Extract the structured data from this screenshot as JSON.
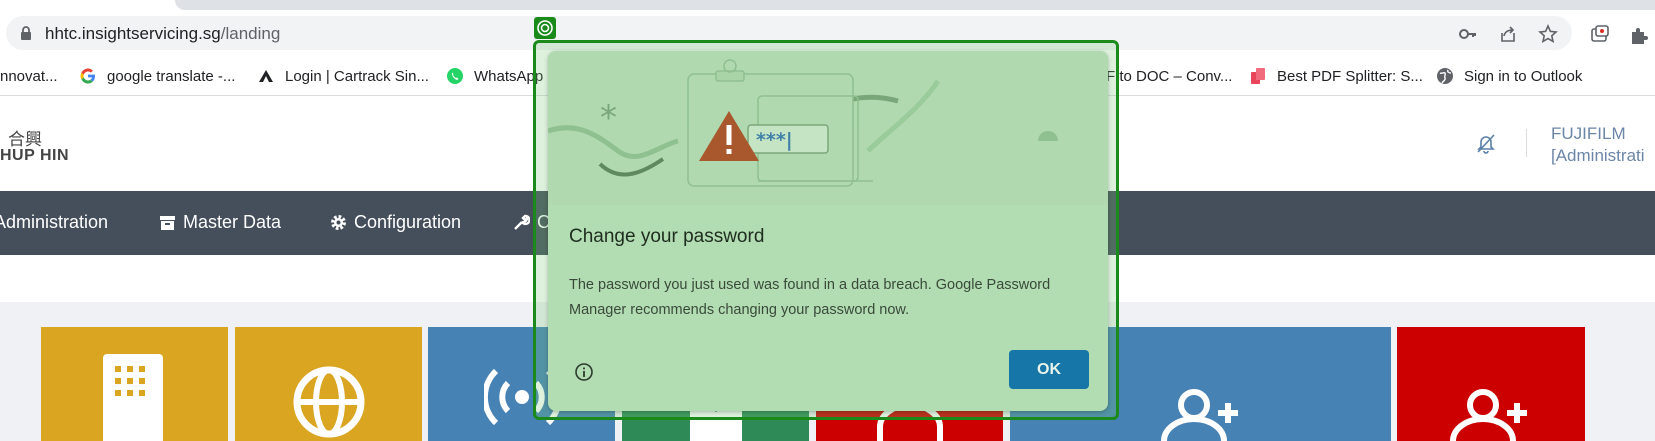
{
  "browser": {
    "url_host": "hhtc.insightservicing.sg",
    "url_path": "/landing",
    "bookmarks": [
      {
        "label": "nnovat...",
        "icon": "blank-icon"
      },
      {
        "label": "google translate -...",
        "icon": "google-icon"
      },
      {
        "label": "Login | Cartrack Sin...",
        "icon": "cartrack-icon"
      },
      {
        "label": "WhatsApp",
        "icon": "whatsapp-icon"
      },
      {
        "label": "F to DOC – Conv...",
        "icon": "doc-icon"
      },
      {
        "label": "Best PDF Splitter: S...",
        "icon": "pdf-icon"
      },
      {
        "label": "Sign in to Outlook",
        "icon": "globe-icon"
      }
    ]
  },
  "header": {
    "logo_cn": "合興",
    "logo_en": "HUP HIN",
    "user_line1": "FUJIFILM",
    "user_line2": "[Administrati"
  },
  "nav": {
    "items": [
      {
        "label": "Administration",
        "icon": "none"
      },
      {
        "label": "Master Data",
        "icon": "archive-icon"
      },
      {
        "label": "Configuration",
        "icon": "gear-icon"
      },
      {
        "label": "C",
        "icon": "wrench-icon"
      }
    ]
  },
  "tiles": {
    "colors": [
      "#daa520",
      "#daa520",
      "#4682b4",
      "#2e8b57",
      "#cc0000",
      "#4682b4",
      "#cc0000"
    ]
  },
  "dialog": {
    "title": "Change your password",
    "body": "The password you just used was found in a data breach. Google Password Manager recommends changing your password now.",
    "ok_label": "OK",
    "password_mask": "***|"
  }
}
